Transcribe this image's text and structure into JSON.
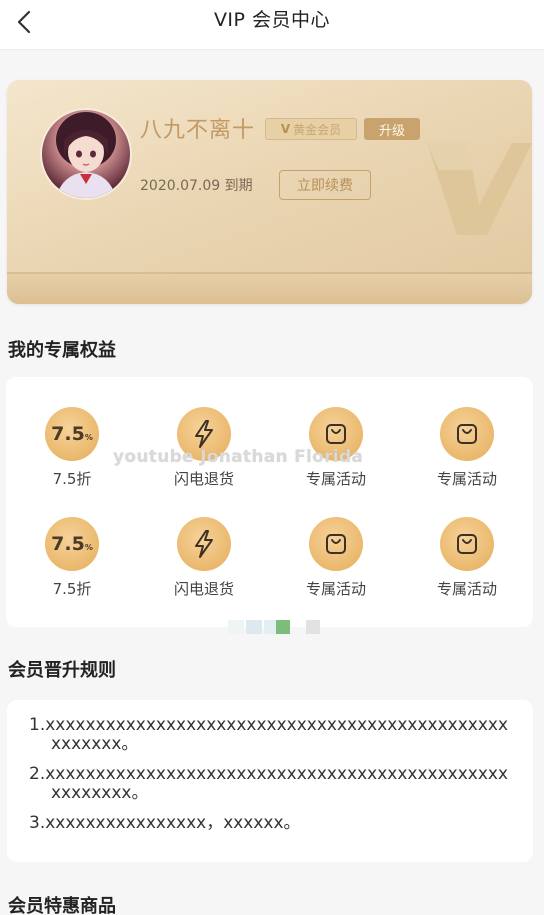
{
  "header": {
    "title": "VIP 会员中心"
  },
  "vip_card": {
    "username": "八九不离十",
    "badge_gold": "黄金会员",
    "badge_upgrade": "升级",
    "expire_text": "2020.07.09 到期",
    "renew_label": "立即续费"
  },
  "sections": {
    "benefits_title": "我的专属权益",
    "rules_title": "会员晋升规则",
    "products_title": "会员特惠商品"
  },
  "benefits": [
    {
      "icon": "discount-75-icon",
      "label": "7.5折"
    },
    {
      "icon": "lightning-icon",
      "label": "闪电退货"
    },
    {
      "icon": "shopping-bag-icon",
      "label": "专属活动"
    },
    {
      "icon": "shopping-bag-icon",
      "label": "专属活动"
    },
    {
      "icon": "discount-75-icon",
      "label": "7.5折"
    },
    {
      "icon": "lightning-icon",
      "label": "闪电退货"
    },
    {
      "icon": "shopping-bag-icon",
      "label": "专属活动"
    },
    {
      "icon": "shopping-bag-icon",
      "label": "专属活动"
    }
  ],
  "discount_value": "7.5",
  "discount_unit": "%",
  "rules": [
    "1.xxxxxxxxxxxxxxxxxxxxxxxxxxxxxxxxxxxxxxxxxxxxxxxxxxxxx。",
    "2.xxxxxxxxxxxxxxxxxxxxxxxxxxxxxxxxxxxxxxxxxxxxxxxxxxxxxx。",
    "3.xxxxxxxxxxxxxxxx，xxxxxx。"
  ],
  "watermark": "youtube Jonathan Florida",
  "colors": {
    "gold": "#c39a63",
    "icon_gold": "#eab86c",
    "card_bg": "#f0dfc0"
  }
}
